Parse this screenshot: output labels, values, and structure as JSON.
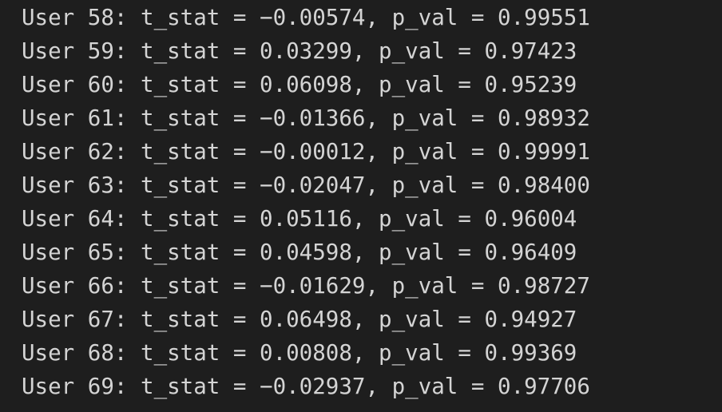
{
  "output": {
    "lines": [
      "User 58: t_stat = −0.00574, p_val = 0.99551",
      "User 59: t_stat = 0.03299, p_val = 0.97423",
      "User 60: t_stat = 0.06098, p_val = 0.95239",
      "User 61: t_stat = −0.01366, p_val = 0.98932",
      "User 62: t_stat = −0.00012, p_val = 0.99991",
      "User 63: t_stat = −0.02047, p_val = 0.98400",
      "User 64: t_stat = 0.05116, p_val = 0.96004",
      "User 65: t_stat = 0.04598, p_val = 0.96409",
      "User 66: t_stat = −0.01629, p_val = 0.98727",
      "User 67: t_stat = 0.06498, p_val = 0.94927",
      "User 68: t_stat = 0.00808, p_val = 0.99369",
      "User 69: t_stat = −0.02937, p_val = 0.97706"
    ]
  },
  "colors": {
    "background": "#1e1e1e",
    "text": "#d4d4d4"
  }
}
